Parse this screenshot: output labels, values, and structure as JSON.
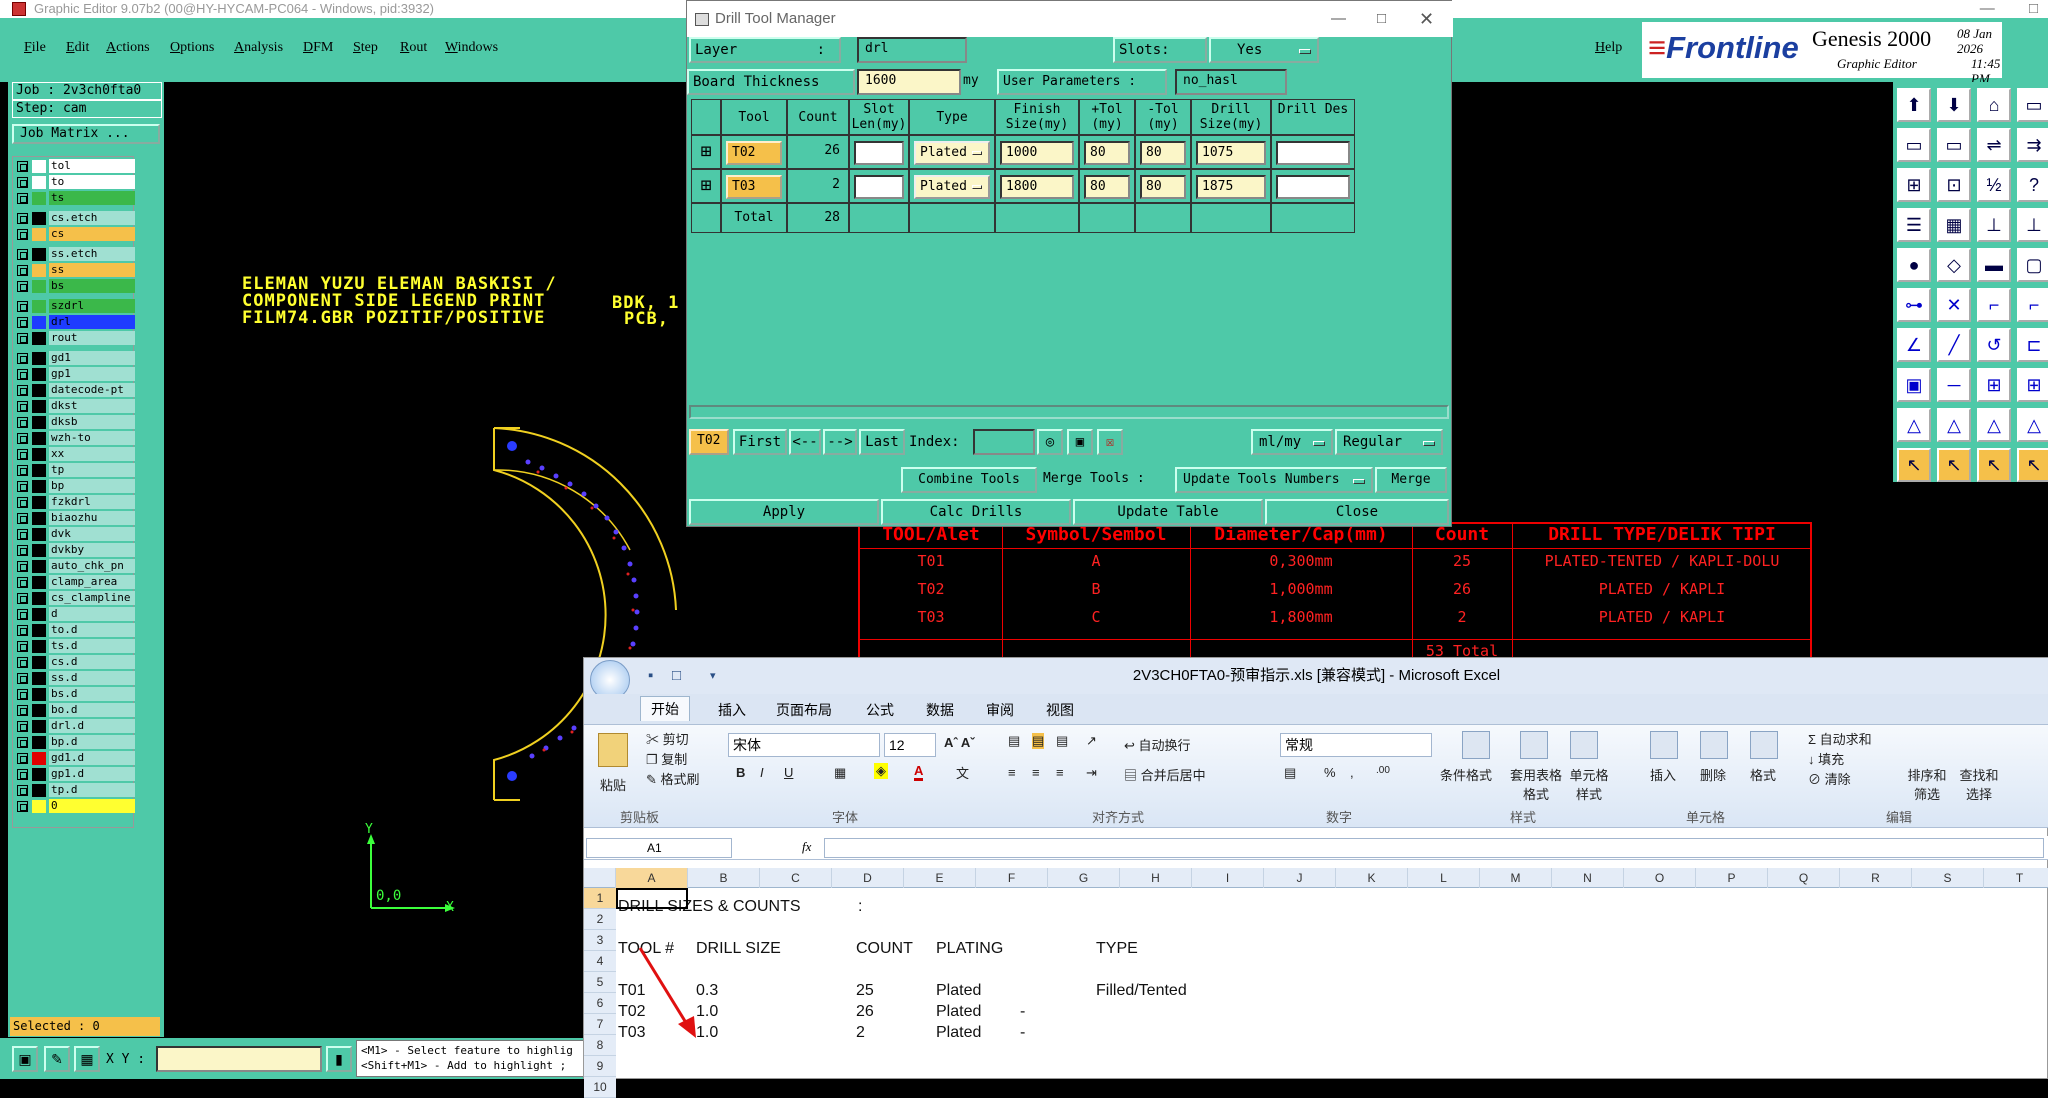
{
  "genesis": {
    "title": "Graphic Editor 9.07b2 (00@HY-HYCAM-PC064 - Windows, pid:3932)",
    "menu": [
      "File",
      "Edit",
      "Actions",
      "Options",
      "Analysis",
      "DFM",
      "Step",
      "Rout",
      "Windows"
    ],
    "help": "Help",
    "brand": {
      "frontline": "Frontline",
      "product": "Genesis 2000",
      "sub": "Graphic Editor",
      "date": "08 Jan 2026",
      "time": "11:45 PM"
    },
    "job": "Job : 2v3ch0fta0",
    "step": "Step: cam",
    "job_matrix": "Job Matrix ...",
    "layers": [
      {
        "name": "tol",
        "color": "#ffffff"
      },
      {
        "name": "to",
        "color": "#ffffff"
      },
      {
        "name": "ts",
        "color": "#3bb84a"
      },
      {
        "name": "cs.etch",
        "color": "#000000"
      },
      {
        "name": "cs",
        "color": "#f5c04a"
      },
      {
        "name": "ss.etch",
        "color": "#000000"
      },
      {
        "name": "ss",
        "color": "#f5c04a"
      },
      {
        "name": "bs",
        "color": "#3bb84a"
      },
      {
        "name": "szdrl",
        "color": "#3bb84a"
      },
      {
        "name": "drl",
        "color": "#1e3cff"
      },
      {
        "name": "rout",
        "color": "#000000"
      },
      {
        "name": "gd1",
        "color": "#000000"
      },
      {
        "name": "gp1",
        "color": "#000000"
      },
      {
        "name": "datecode-pt",
        "color": "#000000"
      },
      {
        "name": "dkst",
        "color": "#000000"
      },
      {
        "name": "dksb",
        "color": "#000000"
      },
      {
        "name": "wzh-to",
        "color": "#000000"
      },
      {
        "name": "xx",
        "color": "#000000"
      },
      {
        "name": "tp",
        "color": "#000000"
      },
      {
        "name": "bp",
        "color": "#000000"
      },
      {
        "name": "fzkdrl",
        "color": "#000000"
      },
      {
        "name": "biaozhu",
        "color": "#000000"
      },
      {
        "name": "dvk",
        "color": "#000000"
      },
      {
        "name": "dvkby",
        "color": "#000000"
      },
      {
        "name": "auto_chk_pn",
        "color": "#000000"
      },
      {
        "name": "clamp_area",
        "color": "#000000"
      },
      {
        "name": "cs_clampline",
        "color": "#000000"
      },
      {
        "name": "d",
        "color": "#000000"
      },
      {
        "name": "to.d",
        "color": "#000000"
      },
      {
        "name": "ts.d",
        "color": "#000000"
      },
      {
        "name": "cs.d",
        "color": "#000000"
      },
      {
        "name": "ss.d",
        "color": "#000000"
      },
      {
        "name": "bs.d",
        "color": "#000000"
      },
      {
        "name": "bo.d",
        "color": "#000000"
      },
      {
        "name": "drl.d",
        "color": "#000000"
      },
      {
        "name": "bp.d",
        "color": "#000000"
      },
      {
        "name": "gd1.d",
        "color": "#e00000"
      },
      {
        "name": "gp1.d",
        "color": "#000000"
      },
      {
        "name": "tp.d",
        "color": "#000000"
      },
      {
        "name": "0",
        "color": "#ffff30"
      }
    ],
    "selected": "Selected : 0",
    "xy_label": "X Y :",
    "hint_line1": "<M1> - Select feature to highlig",
    "hint_line2": "<Shift+M1> - Add to highlight ;",
    "canvas": {
      "line1": "ELEMAN YUZU ELEMAN BASKISI /",
      "line2": "COMPONENT SIDE LEGEND PRINT",
      "line3": "FILM74.GBR  POZITIF/POSITIVE",
      "frag1": "BDK, 1",
      "frag2": "PCB,",
      "origin": "0,0",
      "axis_x": "X",
      "axis_y": "Y"
    }
  },
  "drill_tool_manager": {
    "title": "Drill Tool Manager",
    "layer_label": "Layer",
    "layer_colon": ":",
    "layer_value": "drl",
    "slots_label": "Slots:",
    "slots_value": "Yes",
    "board_thickness_label": "Board Thickness",
    "board_thickness_value": "1600",
    "board_thickness_unit": "my",
    "user_params_label": "User Parameters :",
    "user_params_value": "no_hasl",
    "columns": [
      "Tool",
      "Count",
      "Slot Len(my)",
      "Type",
      "Finish Size(my)",
      "+Tol (my)",
      "-Tol (my)",
      "Drill Size(my)",
      "Drill Des"
    ],
    "rows": [
      {
        "tool": "T02",
        "count": "26",
        "slot": "",
        "type": "Plated",
        "finish": "1000",
        "ptol": "80",
        "mtol": "80",
        "drill": "1075",
        "des": ""
      },
      {
        "tool": "T03",
        "count": "2",
        "slot": "",
        "type": "Plated",
        "finish": "1800",
        "ptol": "80",
        "mtol": "80",
        "drill": "1875",
        "des": ""
      }
    ],
    "total_label": "Total",
    "total_count": "28",
    "current_tool": "T02",
    "nav": {
      "first": "First",
      "prev": "<--",
      "next": "-->",
      "last": "Last",
      "index_label": "Index:"
    },
    "units": "ml/my",
    "mode": "Regular",
    "combine_tools": "Combine Tools",
    "merge_tools_label": "Merge Tools :",
    "update_tools_numbers": "Update Tools Numbers",
    "merge": "Merge",
    "apply": "Apply",
    "calc_drills": "Calc Drills",
    "update_table": "Update Table",
    "close": "Close"
  },
  "legend_table": {
    "headers": [
      "TOOL/Alet",
      "Symbol/Sembol",
      "Diameter/Cap(mm)",
      "Count",
      "DRILL TYPE/DELIK TIPI"
    ],
    "rows": [
      [
        "T01",
        "A",
        "0,300mm",
        "25",
        "PLATED-TENTED / KAPLI-DOLU"
      ],
      [
        "T02",
        "B",
        "1,000mm",
        "26",
        "PLATED / KAPLI"
      ],
      [
        "T03",
        "C",
        "1,800mm",
        "2",
        "PLATED / KAPLI"
      ]
    ],
    "total": "53 Total"
  },
  "excel": {
    "title": "2V3CH0FTA0-预审指示.xls [兼容模式] - Microsoft Excel",
    "tabs": [
      "开始",
      "插入",
      "页面布局",
      "公式",
      "数据",
      "审阅",
      "视图"
    ],
    "clipboard": {
      "paste": "粘贴",
      "cut": "剪切",
      "copy": "复制",
      "format_painter": "格式刷",
      "group": "剪贴板"
    },
    "font": {
      "name": "宋体",
      "size": "12",
      "group": "字体"
    },
    "alignment": {
      "wrap": "自动换行",
      "merge": "合并后居中",
      "group": "对齐方式"
    },
    "number": {
      "format": "常规",
      "group": "数字"
    },
    "styles": {
      "conditional": "条件格式",
      "table": "套用表格格式",
      "cell": "单元格样式",
      "group": "样式"
    },
    "cells": {
      "insert": "插入",
      "delete": "删除",
      "format": "格式",
      "group": "单元格"
    },
    "editing": {
      "autosum": "自动求和",
      "fill": "填充",
      "clear": "清除",
      "sort": "排序和筛选",
      "find": "查找和选择",
      "group": "编辑"
    },
    "name_box": "A1",
    "fx": "fx",
    "columns": [
      "A",
      "B",
      "C",
      "D",
      "E",
      "F",
      "G",
      "H",
      "I",
      "J",
      "K",
      "L",
      "M",
      "N",
      "O",
      "P",
      "Q",
      "R",
      "S",
      "T"
    ],
    "row_numbers": [
      "1",
      "2",
      "3",
      "4",
      "5",
      "6",
      "7",
      "8",
      "9",
      "10"
    ],
    "cells_data": {
      "a1": "DRILL SIZES & COUNTS",
      "d1": ":",
      "a4": "TOOL #",
      "b4": "DRILL SIZE",
      "d4": "COUNT",
      "e4": "PLATING",
      "g4": "TYPE",
      "a6": "T01",
      "b6": "0.3",
      "d6": "25",
      "e6": "Plated",
      "g6": "Filled/Tented",
      "a7": "T02",
      "b7": "1.0",
      "d7": "26",
      "e7": "Plated",
      "f7": "-",
      "a8": "T03",
      "b8": "1.0",
      "d8": "2",
      "e8": "Plated",
      "f8": "-"
    }
  }
}
